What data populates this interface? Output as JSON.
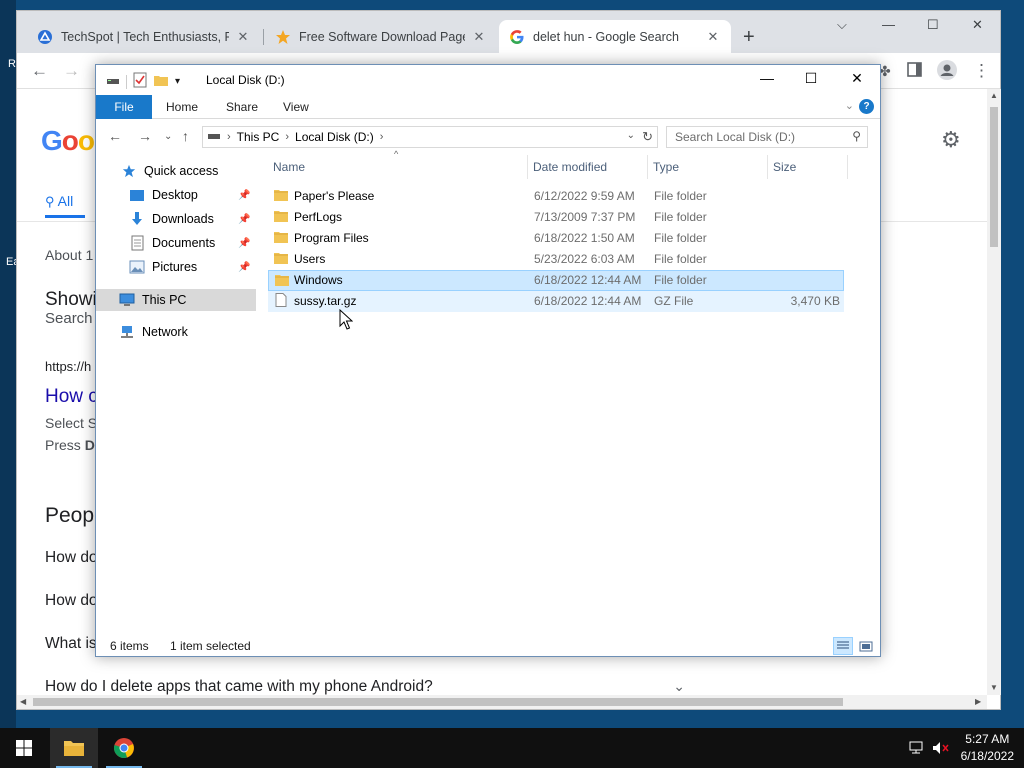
{
  "desktop": {
    "edge_text_1": "R",
    "edge_text_2": "Ea"
  },
  "chrome": {
    "tabs": [
      {
        "title": "TechSpot | Tech Enthusiasts, Pow",
        "icon": "techspot-icon"
      },
      {
        "title": "Free Software Download Page -",
        "icon": "star-icon"
      },
      {
        "title": "delet hun - Google Search",
        "icon": "google-icon"
      }
    ],
    "new_tab": "+",
    "google_logo": "Goo",
    "all_tab": "All",
    "result_stats": "About 1",
    "showing": "Showi",
    "search_for": "Search",
    "url": "https://h",
    "result_title": "How c",
    "snippet_1": "Select S",
    "snippet_2_prefix": "Press ",
    "snippet_2_bold": "D",
    "people_also_ask": "Peop",
    "paa": [
      "How do",
      "How do",
      "What is",
      "How do I delete apps that came with my phone Android?"
    ]
  },
  "explorer": {
    "title": "Local Disk (D:)",
    "ribbon_tabs": [
      "File",
      "Home",
      "Share",
      "View"
    ],
    "breadcrumb": [
      "This PC",
      "Local Disk (D:)"
    ],
    "search_placeholder": "Search Local Disk (D:)",
    "nav": {
      "quick_access": "Quick access",
      "desktop": "Desktop",
      "downloads": "Downloads",
      "documents": "Documents",
      "pictures": "Pictures",
      "this_pc": "This PC",
      "network": "Network"
    },
    "columns": [
      "Name",
      "Date modified",
      "Type",
      "Size"
    ],
    "files": [
      {
        "name": "Paper's Please",
        "date": "6/12/2022 9:59 AM",
        "type": "File folder",
        "size": ""
      },
      {
        "name": "PerfLogs",
        "date": "7/13/2009 7:37 PM",
        "type": "File folder",
        "size": ""
      },
      {
        "name": "Program Files",
        "date": "6/18/2022 1:50 AM",
        "type": "File folder",
        "size": ""
      },
      {
        "name": "Users",
        "date": "5/23/2022 6:03 AM",
        "type": "File folder",
        "size": ""
      },
      {
        "name": "Windows",
        "date": "6/18/2022 12:44 AM",
        "type": "File folder",
        "size": ""
      },
      {
        "name": "sussy.tar.gz",
        "date": "6/18/2022 12:44 AM",
        "type": "GZ File",
        "size": "3,470 KB"
      }
    ],
    "status_count": "6 items",
    "status_selected": "1 item selected"
  },
  "taskbar": {
    "time": "5:27 AM",
    "date": "6/18/2022"
  },
  "colors": {
    "accent": "#1979ca",
    "selection": "#cce8ff",
    "folder": "#f1c454",
    "link": "#1a0dab"
  }
}
